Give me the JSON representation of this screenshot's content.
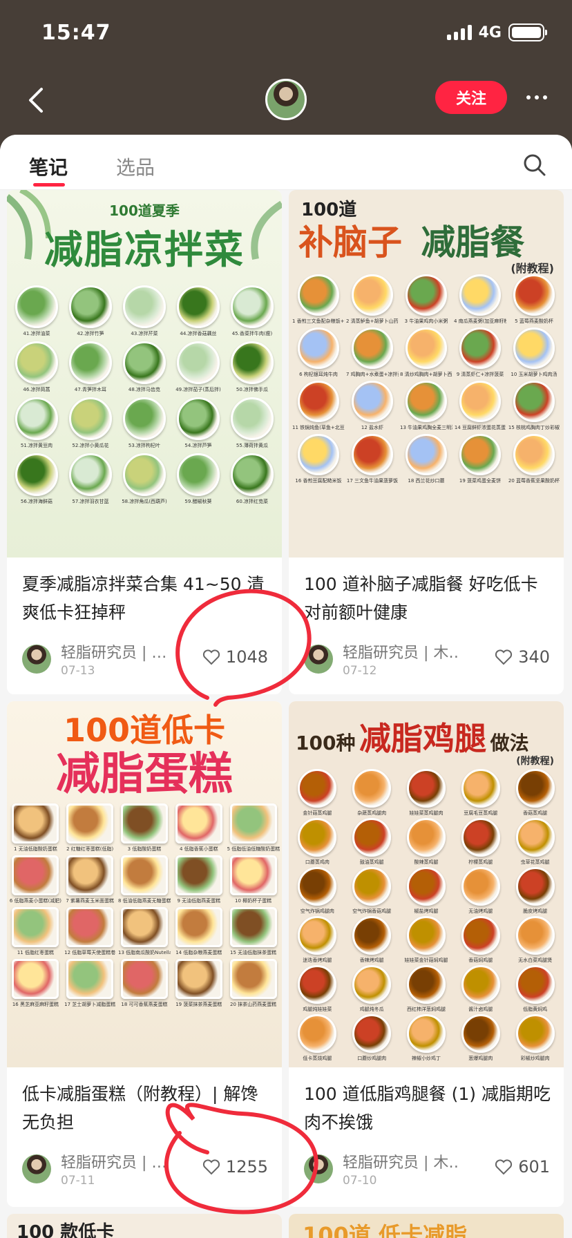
{
  "status_bar": {
    "time": "15:47",
    "network": "4G"
  },
  "nav": {
    "follow_label": "关注"
  },
  "tabs": {
    "notes": "笔记",
    "products": "选品"
  },
  "cards": [
    {
      "image": {
        "top_small": "100道夏季",
        "title": "减脂凉拌菜",
        "accent": "#2f8a3c",
        "bg": "#e9f1dc",
        "dishes": [
          "41.凉拌油菜",
          "42.凉拌竹笋",
          "43.凉拌芹菜",
          "44.凉拌香菇藕丝",
          "45.香菜拌牛肉(瘦)",
          "46.凉拌茼蒿",
          "47.青笋拌木耳",
          "48.凉拌马齿苋",
          "49.凉拌茄子(蒸后拌)",
          "50.凉拌佛手瓜",
          "51.凉拌黄豆肉",
          "52.凉拌小黄瓜花",
          "53.凉拌枸杞叶",
          "54.凉拌芦笋",
          "55.薄荷拌黄瓜",
          "56.凉拌海鲜菇",
          "57.凉拌羽衣甘蓝",
          "58.凉拌角瓜(西葫芦)",
          "59.醋椒秋葵",
          "60.凉拌红苋菜"
        ]
      },
      "title": "夏季减脂凉拌菜合集 41~50 清爽低卡狂掉秤",
      "author": "轻脂研究员 | …",
      "date": "07-13",
      "likes": "1048"
    },
    {
      "image": {
        "top_small": "100道",
        "title_a": "补脑子",
        "title_b": "减脂餐",
        "subtitle": "(附教程)",
        "bg": "#f1e9dc",
        "dishes": [
          "1 香煎三文鱼配杂粮饭+清炒西兰花",
          "2 清蒸鲈鱼+胡萝卜山药丁",
          "3 牛油果鸡肉小米粥",
          "4 南瓜燕麦粥(加亚麻籽粉)",
          "5 蓝莓燕麦酸奶杯",
          "6 枸杞银耳炖牛肉",
          "7 鸡胸肉+水煮蛋+凉拌黄瓜",
          "8 清炒鸡胸肉+胡萝卜西兰花",
          "9 清蒸虾仁+凉拌菠菜",
          "10 玉米胡萝卜鸡肉汤",
          "11 铁锅炖鱼(草鱼+北豆腐)",
          "12 盐水虾",
          "13 牛油果鸡胸全麦三明治",
          "14 豆腐鲜虾浓蛋花蒸蛋",
          "15 核桃鸡胸肉丁炒彩椒",
          "16 香煎豆腐配糙米饭",
          "17 三文鱼牛油果菠萝饭",
          "18 西兰花炒口蘑",
          "19 菠菜鸡蛋全麦饼",
          "20 蓝莓香蕉坚果酸奶杯"
        ]
      },
      "title": "100 道补脑子减脂餐 好吃低卡对前额叶健康",
      "author": "轻脂研究员 | 木…",
      "date": "07-12",
      "likes": "340"
    },
    {
      "image": {
        "top_small": "100道低卡",
        "title_a": "减脂",
        "title_b": "蛋糕",
        "bg": "#f3ecdd",
        "dishes": [
          "1 无油低脂酸奶蛋糕",
          "2 红糖红枣蛋糕(低脂)",
          "3 低脂酸奶蛋糕",
          "4 低脂香蕉小蛋糕",
          "5 低脂低油低糖酸奶蛋糕",
          "6 低脂燕麦小蛋糕(减肥)",
          "7 紫薯燕麦玉米面蛋糕",
          "8 低油低脂燕麦无糖蛋糕",
          "9 无油低脂燕麦蛋糕",
          "10 椰奶杯子蛋糕",
          "11 低脂红枣蛋糕",
          "12 低脂草莓天使蛋糕卷",
          "13 低脂南瓜酸奶Nutella乳酪蛋糕",
          "14 低脂杂粮燕麦蛋糕",
          "15 无油低脂抹茶蛋糕",
          "16 黑芝麻亚麻籽蛋糕",
          "17 芝士胡萝卜减脂蛋糕",
          "18 可可香蕉燕麦蛋糕",
          "19 菠菜抹茶燕麦蛋糕",
          "20 抹茶山药燕麦蛋糕"
        ]
      },
      "title": "低卡减脂蛋糕（附教程）| 解馋无负担",
      "author": "轻脂研究员 | …",
      "date": "07-11",
      "likes": "1255"
    },
    {
      "image": {
        "top_small": "100种",
        "title": "减脂鸡腿",
        "title_c": "做法",
        "subtitle": "(附教程)",
        "bg": "#f1e6d6",
        "dishes": [
          "金针菇蒸鸡腿",
          "杂蔬蒸鸡腿肉",
          "娃娃菜蒸鸡腿肉",
          "豆腐毛豆蒸鸡腿",
          "香菇蒸鸡腿",
          "口蘑蒸鸡肉",
          "鼓油蒸鸡腿",
          "酸辣蒸鸡腿",
          "柠檬蒸鸡腿",
          "虫草花蒸鸡腿",
          "空气炸锅鸡腿肉",
          "空气炸锅香菇鸡腿",
          "椒盐烤鸡腿",
          "无油烤鸡腿",
          "脆皮烤鸡腿",
          "迷迭香烤鸡腿",
          "香辣烤鸡腿",
          "娃娃菜金针菇焖鸡腿",
          "香菇焖鸡腿",
          "无水白菜鸡腿煲",
          "鸡腿炖娃娃菜",
          "鸡腿炖冬瓜",
          "西红柿洋葱焖鸡腿",
          "酱汁卤鸡腿",
          "低脂黄焖鸡",
          "低卡蒸烧鸡腿",
          "口蘑炒鸡腿肉",
          "辣椒小炒鸡丁",
          "葱爆鸡腿肉",
          "彩椒炒鸡腿肉"
        ]
      },
      "title": "100 道低脂鸡腿餐 (1) 减脂期吃肉不挨饿",
      "author": "轻脂研究员 | 木…",
      "date": "07-10",
      "likes": "601"
    }
  ],
  "peek_cards": [
    {
      "text": "100 款低卡"
    },
    {
      "text": "100道 低卡减脂"
    }
  ]
}
